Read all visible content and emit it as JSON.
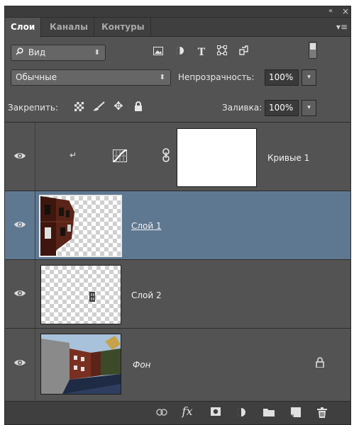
{
  "panel": {
    "collapse_glyph": "«",
    "close_glyph": "×",
    "menu_glyph": "▾≡"
  },
  "tabs": [
    {
      "label": "Слои",
      "active": true
    },
    {
      "label": "Каналы",
      "active": false
    },
    {
      "label": "Контуры",
      "active": false
    }
  ],
  "filter": {
    "kind_label": "Вид",
    "kind_arrow": "⬍",
    "icons": [
      "image-filter-icon",
      "adjustment-filter-icon",
      "type-filter-icon",
      "shape-filter-icon",
      "smart-object-filter-icon"
    ],
    "type_glyph": "T"
  },
  "blend": {
    "mode_label": "Обычные",
    "mode_arrow": "⬍",
    "opacity_label": "Непрозрачность:",
    "opacity_value": "100%",
    "value_arrow": "▾"
  },
  "locks": {
    "label": "Закрепить:",
    "fill_label": "Заливка:",
    "fill_value": "100%",
    "value_arrow": "▾",
    "icons": [
      "lock-pixels-icon",
      "lock-brush-icon",
      "lock-position-icon",
      "lock-all-icon"
    ]
  },
  "layers": [
    {
      "name": "Кривые 1",
      "type": "adjustment",
      "visible": true,
      "selected": false,
      "clipped": true,
      "linked_mask": true,
      "italic": false,
      "locked": false
    },
    {
      "name": "Слой 1",
      "type": "pixel",
      "visible": true,
      "selected": true,
      "clipped": false,
      "italic": false,
      "locked": false
    },
    {
      "name": "Слой 2",
      "type": "pixel",
      "visible": true,
      "selected": false,
      "clipped": false,
      "italic": false,
      "locked": false
    },
    {
      "name": "Фон",
      "type": "background",
      "visible": true,
      "selected": false,
      "clipped": false,
      "italic": true,
      "locked": true
    }
  ],
  "footer": {
    "fx_label": "fx",
    "icons": [
      "link-layers-icon",
      "fx-icon",
      "add-mask-icon",
      "new-adjustment-icon",
      "new-group-icon",
      "new-layer-icon",
      "delete-icon"
    ]
  },
  "colors": {
    "panel_bg": "#535353",
    "selected_row": "#5f7891",
    "tab_bar": "#3f3f3f"
  }
}
